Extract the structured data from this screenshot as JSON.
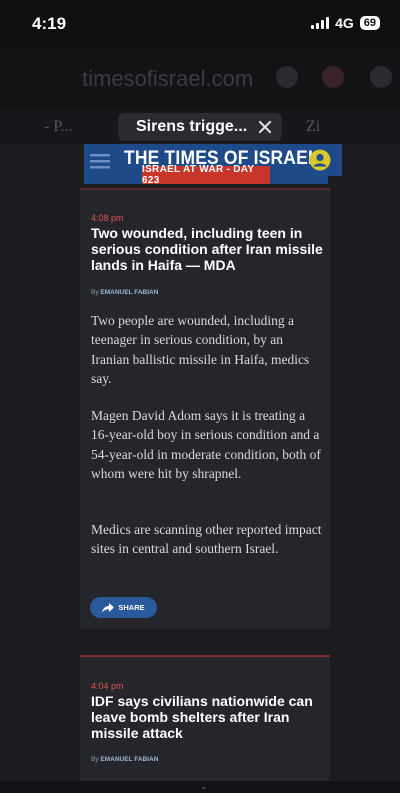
{
  "status_bar": {
    "time": "4:19",
    "network": "4G",
    "battery": "69"
  },
  "browser": {
    "url": "timesofisrael.com",
    "tab_left": "- P...",
    "tab_current": "Sirens trigge...",
    "tab_right": "Zi"
  },
  "site": {
    "logo": "THE TIMES OF ISRAEL",
    "badge": "ISRAEL AT WAR - DAY 623"
  },
  "articles": [
    {
      "time": "4:08 pm",
      "headline": "Two wounded, including teen in serious condition after Iran missile lands in Haifa — MDA",
      "byline_prefix": "By",
      "author": "EMANUEL FABIAN",
      "paragraphs": [
        "Two people are wounded, including a teenager in serious condition, by an Iranian ballistic missile in Haifa, medics say.",
        "Magen David Adom says it is treating a 16-year-old boy in serious condition and a 54-year-old in moderate condition, both of whom were hit by shrapnel.",
        "Medics are scanning other reported impact sites in central and southern Israel."
      ],
      "share_label": "SHARE"
    },
    {
      "time": "4:04 pm",
      "headline": "IDF says civilians nationwide can leave bomb shelters after Iran missile attack",
      "byline_prefix": "By",
      "author": "EMANUEL FABIAN"
    }
  ],
  "colors": {
    "accent_red": "#e0574f",
    "header_blue": "#1f4a8a",
    "badge_red": "#c8362a",
    "share_blue": "#2a5a9c"
  }
}
